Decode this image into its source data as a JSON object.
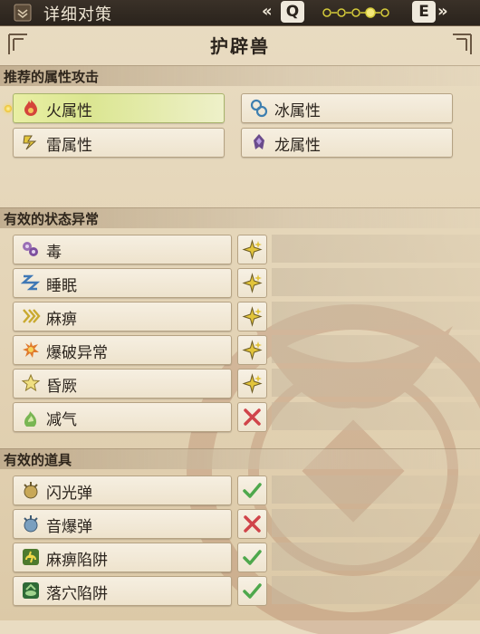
{
  "header": {
    "title": "详细对策",
    "nav_left": "«",
    "key_prev": "Q",
    "key_next": "E",
    "nav_right": "»",
    "page_indicator": {
      "total": 5,
      "current": 4
    }
  },
  "monster_name": "护辟兽",
  "sections": {
    "elements": {
      "title": "推荐的属性攻击",
      "items": [
        {
          "label": "火属性",
          "icon": "fire-icon",
          "selected": true
        },
        {
          "label": "冰属性",
          "icon": "ice-icon"
        },
        {
          "label": "雷属性",
          "icon": "thunder-icon"
        },
        {
          "label": "龙属性",
          "icon": "dragon-icon"
        }
      ]
    },
    "status": {
      "title": "有效的状态异常",
      "items": [
        {
          "label": "毒",
          "icon": "poison-icon",
          "effect": "star"
        },
        {
          "label": "睡眠",
          "icon": "sleep-icon",
          "effect": "star"
        },
        {
          "label": "麻痹",
          "icon": "paralysis-icon",
          "effect": "star"
        },
        {
          "label": "爆破异常",
          "icon": "blast-icon",
          "effect": "star"
        },
        {
          "label": "昏厥",
          "icon": "stun-icon",
          "effect": "star"
        },
        {
          "label": "减气",
          "icon": "exhaust-icon",
          "effect": "cross"
        }
      ]
    },
    "items": {
      "title": "有效的道具",
      "items": [
        {
          "label": "闪光弹",
          "icon": "flash-pod-icon",
          "effect": "check"
        },
        {
          "label": "音爆弹",
          "icon": "sonic-bomb-icon",
          "effect": "cross"
        },
        {
          "label": "麻痹陷阱",
          "icon": "shock-trap-icon",
          "effect": "check"
        },
        {
          "label": "落穴陷阱",
          "icon": "pitfall-trap-icon",
          "effect": "check"
        }
      ]
    }
  },
  "colors": {
    "star": "#e2c43a",
    "cross": "#d0444a",
    "check": "#4ea84c",
    "selected": "#dbe691"
  }
}
